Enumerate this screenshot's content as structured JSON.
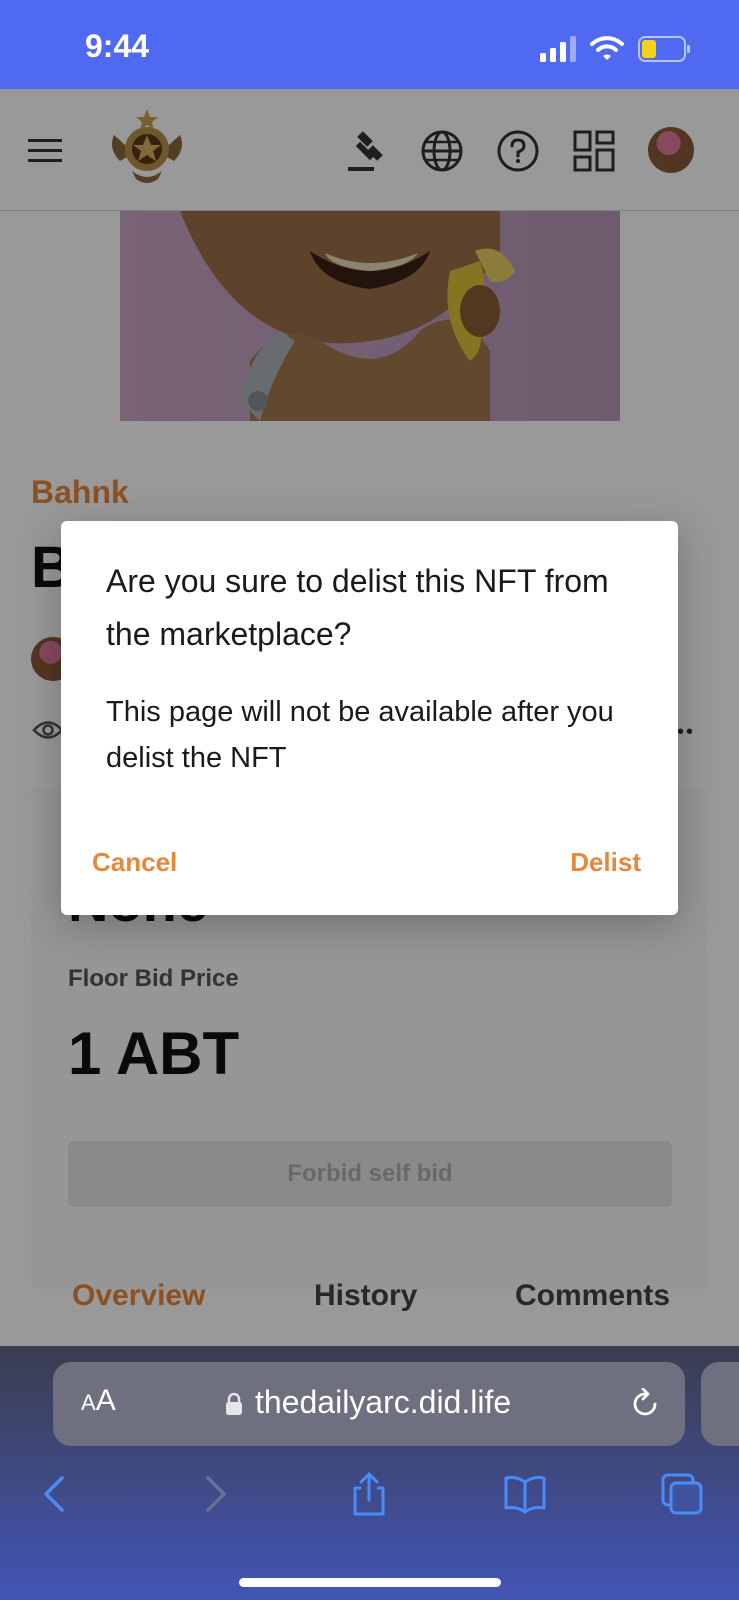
{
  "status_bar": {
    "time": "9:44"
  },
  "page": {
    "collection_name": "Bahnk",
    "nft_title_initial": "B",
    "price_value": "None",
    "floor_bid_label": "Floor Bid Price",
    "floor_bid_value": "1 ABT",
    "bid_button_label": "Forbid self bid",
    "more_label": "•••",
    "tabs": [
      {
        "label": "Overview"
      },
      {
        "label": "History"
      },
      {
        "label": "Comments"
      }
    ]
  },
  "dialog": {
    "title": "Are you sure to delist this NFT from the marketplace?",
    "body": "This page will not be available after you delist the NFT",
    "cancel_label": "Cancel",
    "confirm_label": "Delist"
  },
  "browser": {
    "text_size_label_small": "A",
    "text_size_label_large": "A",
    "url": "thedailyarc.did.life"
  },
  "colors": {
    "status_bar": "#4F6AF0",
    "accent_orange": "#E8873A",
    "browser_bar": "#3f4a86"
  },
  "icons": [
    "signal-icon",
    "wifi-icon",
    "battery-icon",
    "menu-icon",
    "logo-icon",
    "auction-icon",
    "globe-icon",
    "help-icon",
    "apps-icon",
    "views-icon",
    "lock-icon",
    "reload-icon",
    "back-icon",
    "forward-icon",
    "share-icon",
    "bookmarks-icon",
    "tabs-icon"
  ]
}
